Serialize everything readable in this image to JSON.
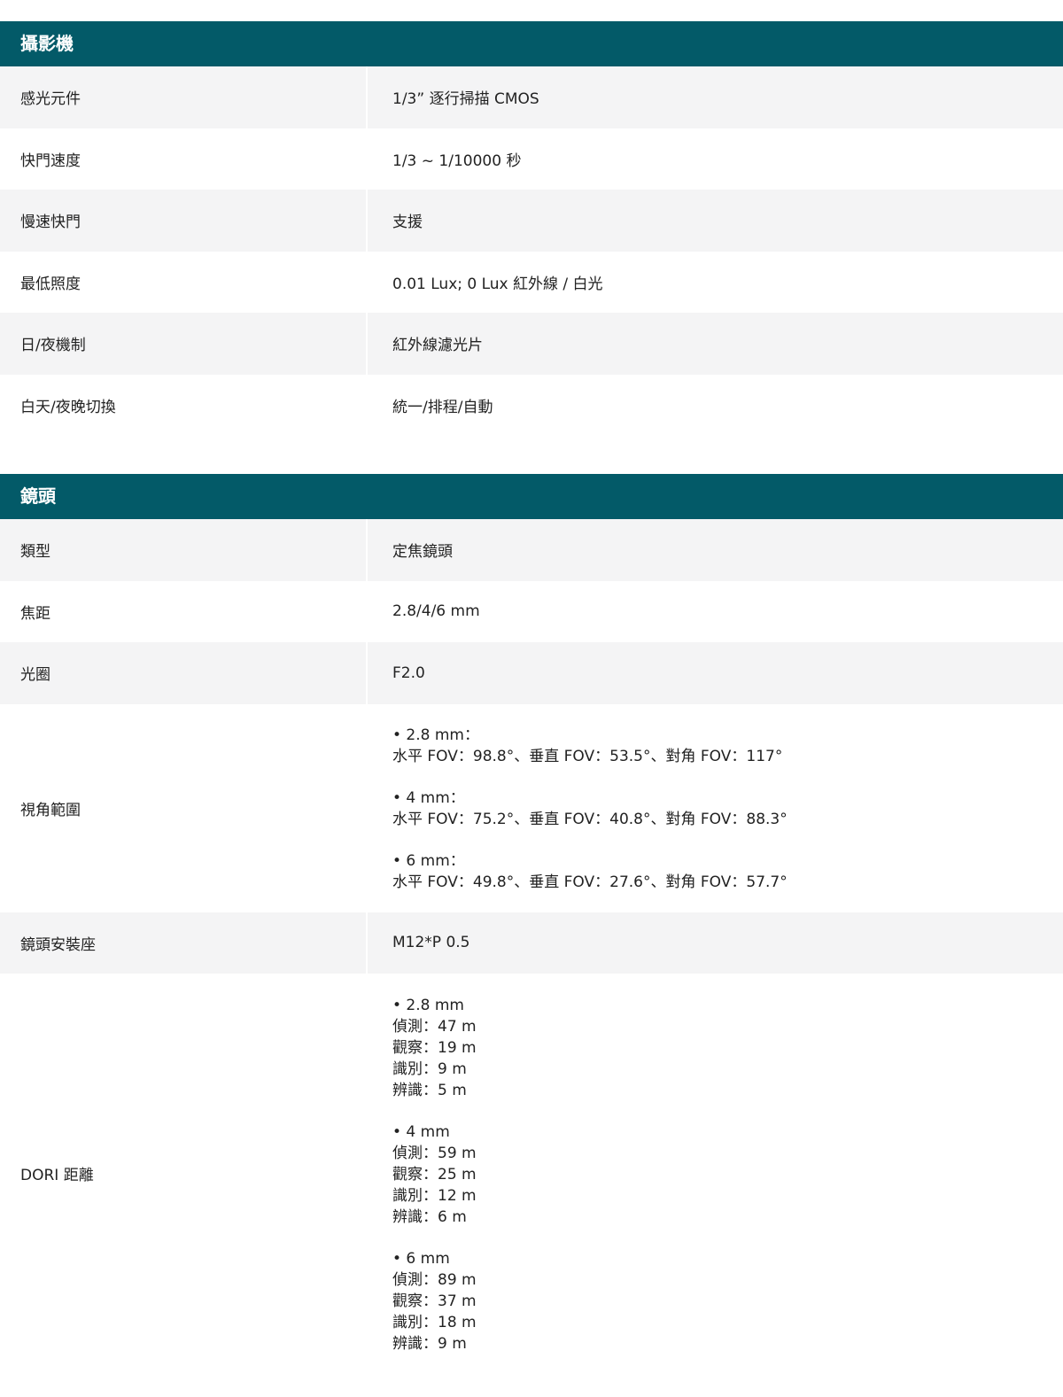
{
  "sections": [
    {
      "title": "攝影機",
      "rows": [
        {
          "label": "感光元件",
          "value": "1/3” 逐行掃描 CMOS"
        },
        {
          "label": "快門速度",
          "value": "1/3 ~ 1/10000 秒"
        },
        {
          "label": "慢速快門",
          "value": "支援"
        },
        {
          "label": "最低照度",
          "value": "0.01 Lux; 0 Lux 紅外線 / 白光"
        },
        {
          "label": "日/夜機制",
          "value": "紅外線濾光片"
        },
        {
          "label": "白天/夜晚切換",
          "value": "統一/排程/自動"
        }
      ]
    },
    {
      "title": "鏡頭",
      "rows": [
        {
          "label": "類型",
          "value": "定焦鏡頭"
        },
        {
          "label": "焦距",
          "value": "2.8/4/6 mm"
        },
        {
          "label": "光圈",
          "value": "F2.0"
        },
        {
          "label": "視角範圍",
          "groups": [
            [
              "• 2.8 mm：",
              "水平 FOV：98.8°、垂直 FOV：53.5°、對角 FOV：117°"
            ],
            [
              "• 4 mm：",
              "水平 FOV：75.2°、垂直 FOV：40.8°、對角 FOV：88.3°"
            ],
            [
              "• 6 mm：",
              "水平 FOV：49.8°、垂直 FOV：27.6°、對角 FOV：57.7°"
            ]
          ]
        },
        {
          "label": "鏡頭安裝座",
          "value": "M12*P 0.5"
        },
        {
          "label": "DORI 距離",
          "groups": [
            [
              "• 2.8 mm",
              "偵測：47 m",
              "觀察：19 m",
              "識別：9 m",
              "辨識：5 m"
            ],
            [
              "• 4 mm",
              "偵測：59 m",
              "觀察：25 m",
              "識別：12 m",
              "辨識：6 m"
            ],
            [
              "• 6 mm",
              "偵測：89 m",
              "觀察：37 m",
              "識別：18 m",
              "辨識：9 m"
            ]
          ]
        }
      ]
    }
  ]
}
